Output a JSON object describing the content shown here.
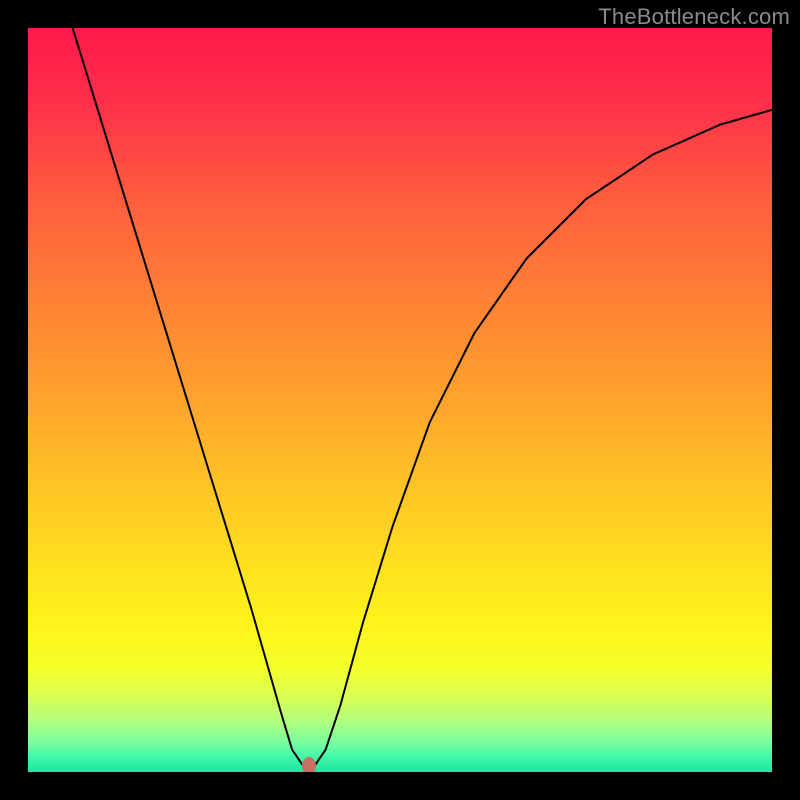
{
  "watermark": {
    "text": "TheBottleneck.com"
  },
  "plot": {
    "gradient_id": "bg-grad",
    "gradient_stops": [
      {
        "offset": "0%",
        "color": "#ff1a4b"
      },
      {
        "offset": "10%",
        "color": "#ff2f4a"
      },
      {
        "offset": "22%",
        "color": "#ff5a3f"
      },
      {
        "offset": "35%",
        "color": "#ff7d36"
      },
      {
        "offset": "48%",
        "color": "#ff9e2e"
      },
      {
        "offset": "60%",
        "color": "#ffbf27"
      },
      {
        "offset": "72%",
        "color": "#ffe01f"
      },
      {
        "offset": "80%",
        "color": "#fff31a"
      },
      {
        "offset": "86%",
        "color": "#f5ff2a"
      },
      {
        "offset": "90%",
        "color": "#d8ff55"
      },
      {
        "offset": "93%",
        "color": "#b4ff7d"
      },
      {
        "offset": "96%",
        "color": "#7aff9e"
      },
      {
        "offset": "98%",
        "color": "#42f7ab"
      },
      {
        "offset": "100%",
        "color": "#18e8a0"
      }
    ],
    "marker": {
      "x_pct": 37.8,
      "y_pct": 99.2,
      "color": "#c86f62"
    }
  },
  "chart_data": {
    "type": "line",
    "title": "",
    "xlabel": "",
    "ylabel": "",
    "xlim": [
      0,
      100
    ],
    "ylim": [
      0,
      100
    ],
    "annotations": [
      "TheBottleneck.com"
    ],
    "series": [
      {
        "name": "bottleneck-curve",
        "x": [
          6,
          10,
          14,
          18,
          22,
          26,
          30,
          32,
          34,
          35.5,
          37,
          38.5,
          40,
          42,
          45,
          49,
          54,
          60,
          67,
          75,
          84,
          93,
          100
        ],
        "y": [
          100,
          87,
          74,
          61,
          48,
          35,
          22,
          15,
          8,
          3,
          0.8,
          0.8,
          3,
          9,
          20,
          33,
          47,
          59,
          69,
          77,
          83,
          87,
          89
        ]
      }
    ],
    "marker_point": {
      "x": 37.8,
      "y": 0.8
    },
    "background": "vertical-gradient red→orange→yellow→green (top=high bottleneck, bottom=low)"
  }
}
